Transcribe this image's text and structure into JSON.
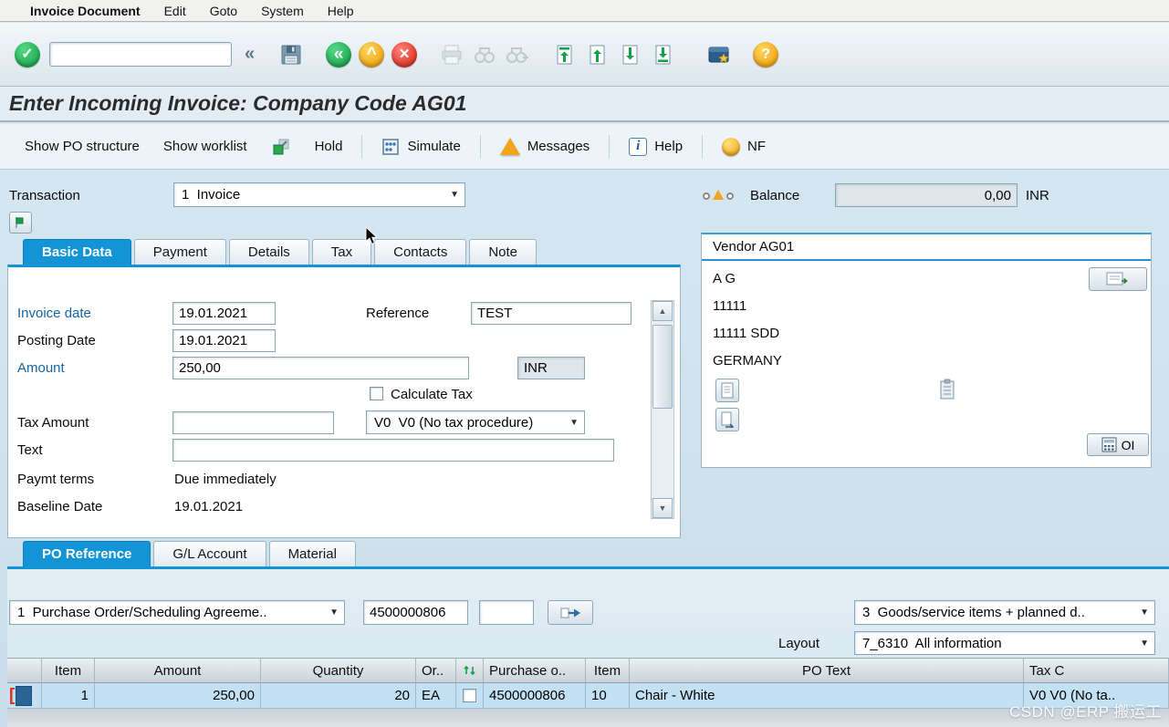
{
  "icons": {
    "check": "✓",
    "collapse": "«",
    "back": "«",
    "exit": "^",
    "cancel": "×",
    "help": "?",
    "info": "i",
    "dropdown": "▼",
    "scroll_up": "▲",
    "scroll_down": "▼",
    "lead_bracket": "["
  },
  "menu": {
    "items": [
      "Invoice Document",
      "Edit",
      "Goto",
      "System",
      "Help"
    ]
  },
  "toolbar": {
    "command_value": ""
  },
  "title": "Enter Incoming Invoice: Company Code AG01",
  "app_toolbar": {
    "show_po_structure": "Show PO structure",
    "show_worklist": "Show worklist",
    "hold": "Hold",
    "simulate": "Simulate",
    "messages": "Messages",
    "help": "Help",
    "nf": "NF"
  },
  "transaction": {
    "label": "Transaction",
    "value": "1  Invoice",
    "balance_label": "Balance",
    "balance_value": "0,00",
    "balance_currency": "INR"
  },
  "tabs": {
    "basic_data": "Basic Data",
    "payment": "Payment",
    "details": "Details",
    "tax": "Tax",
    "contacts": "Contacts",
    "note": "Note"
  },
  "basic_data": {
    "invoice_date_label": "Invoice date",
    "invoice_date": "19.01.2021",
    "reference_label": "Reference",
    "reference": "TEST",
    "posting_date_label": "Posting Date",
    "posting_date": "19.01.2021",
    "amount_label": "Amount",
    "amount": "250,00",
    "currency": "INR",
    "calculate_tax_label": "Calculate Tax",
    "tax_amount_label": "Tax Amount",
    "tax_amount": "",
    "tax_code": "V0  V0 (No tax procedure)",
    "text_label": "Text",
    "text_value": "",
    "paymt_terms_label": "Paymt terms",
    "paymt_terms": "Due immediately",
    "baseline_date_label": "Baseline Date",
    "baseline_date": "19.01.2021"
  },
  "vendor": {
    "header": "Vendor AG01",
    "line1": "A G",
    "line2": "11111",
    "line3": "11111 SDD",
    "line4": "GERMANY",
    "oi_label": "OI"
  },
  "item_tabs": {
    "po_reference": "PO Reference",
    "gl_account": "G/L Account",
    "material": "Material"
  },
  "po_section": {
    "po_type": "1  Purchase Order/Scheduling Agreeme..",
    "po_number": "4500000806",
    "po_item": "",
    "goods_filter": "3  Goods/service items + planned d..",
    "layout_label": "Layout",
    "layout_value": "7_6310  All information"
  },
  "items_table": {
    "columns": [
      "Item",
      "Amount",
      "Quantity",
      "Or..",
      "Purchase o..",
      "Item",
      "PO Text",
      "Tax C"
    ],
    "rows": [
      {
        "item": "1",
        "amount": "250,00",
        "quantity": "20",
        "order_unit": "EA",
        "purchase_order": "4500000806",
        "po_item": "10",
        "po_text": "Chair - White",
        "tax_code": "V0 V0 (No ta.."
      }
    ]
  },
  "watermark": "CSDN @ERP 搬运工"
}
